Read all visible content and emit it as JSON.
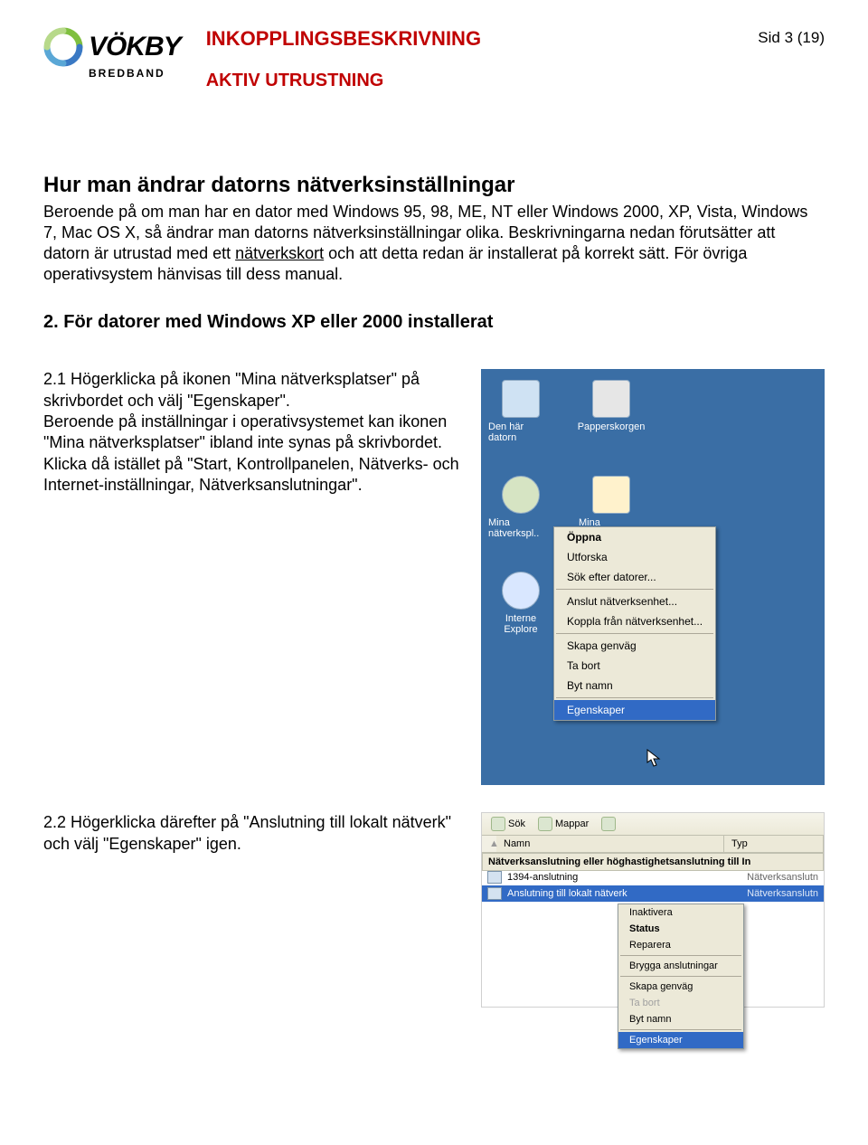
{
  "header": {
    "logo_text": "VÖKBY",
    "logo_sub": "BREDBAND",
    "doc_title": "INKOPPLINGSBESKRIVNING",
    "doc_subtitle": "AKTIV UTRUSTNING",
    "page_num": "Sid 3 (19)"
  },
  "section": {
    "heading": "Hur man ändrar datorns nätverksinställningar",
    "para_a": "Beroende på om man har en dator med Windows 95, 98, ME, NT eller Windows 2000, XP, Vista, Windows 7, Mac OS X, så ändrar man datorns nätverksinställningar olika. Beskrivningarna nedan förutsätter att datorn är utrustad med ett ",
    "para_underlined": "nätverkskort",
    "para_b": " och att detta redan är installerat på korrekt sätt. För övriga operativsystem hänvisas till dess manual.",
    "num_heading": "2.   För datorer med Windows XP eller 2000 installerat"
  },
  "step21": {
    "lead": "2.1 Högerklicka på ikonen \"Mina nätverksplatser\" på skrivbordet och välj \"Egenskaper\".",
    "body1": "Beroende på inställningar i operativsystemet kan ikonen \"Mina nätverksplatser\" ibland inte synas på skrivbordet.",
    "body2": "Klicka då istället på \"Start, Kontrollpanelen, Nätverks- och Internet-inställningar, Nätverksanslutningar\"."
  },
  "step22": {
    "text": "2.2 Högerklicka därefter på \"Anslutning till lokalt nätverk\" och välj \"Egenskaper\" igen."
  },
  "shot1": {
    "icon1": "Den här datorn",
    "icon2": "Papperskorgen",
    "icon3": "Mina nätverkspl..",
    "icon4": "Mina dokument",
    "icon5a": "Interne",
    "icon5b": "Explore",
    "menu": {
      "open": "Öppna",
      "explore": "Utforska",
      "search": "Sök efter datorer...",
      "map": "Anslut nätverksenhet...",
      "unmap": "Koppla från nätverksenhet...",
      "shortcut": "Skapa genväg",
      "delete": "Ta bort",
      "rename": "Byt namn",
      "props": "Egenskaper"
    }
  },
  "shot2": {
    "tb_search": "Sök",
    "tb_folders": "Mappar",
    "col_name": "Namn",
    "col_type": "Typ",
    "banner": "Nätverksanslutning eller höghastighetsanslutning till In",
    "row1_name": "1394-anslutning",
    "row1_type": "Nätverksanslutn",
    "row2_name": "Anslutning till lokalt nätverk",
    "row2_type": "Nätverksanslutn",
    "menu": {
      "disable": "Inaktivera",
      "status": "Status",
      "repair": "Reparera",
      "bridge": "Brygga anslutningar",
      "shortcut": "Skapa genväg",
      "delete": "Ta bort",
      "rename": "Byt namn",
      "props": "Egenskaper"
    }
  }
}
